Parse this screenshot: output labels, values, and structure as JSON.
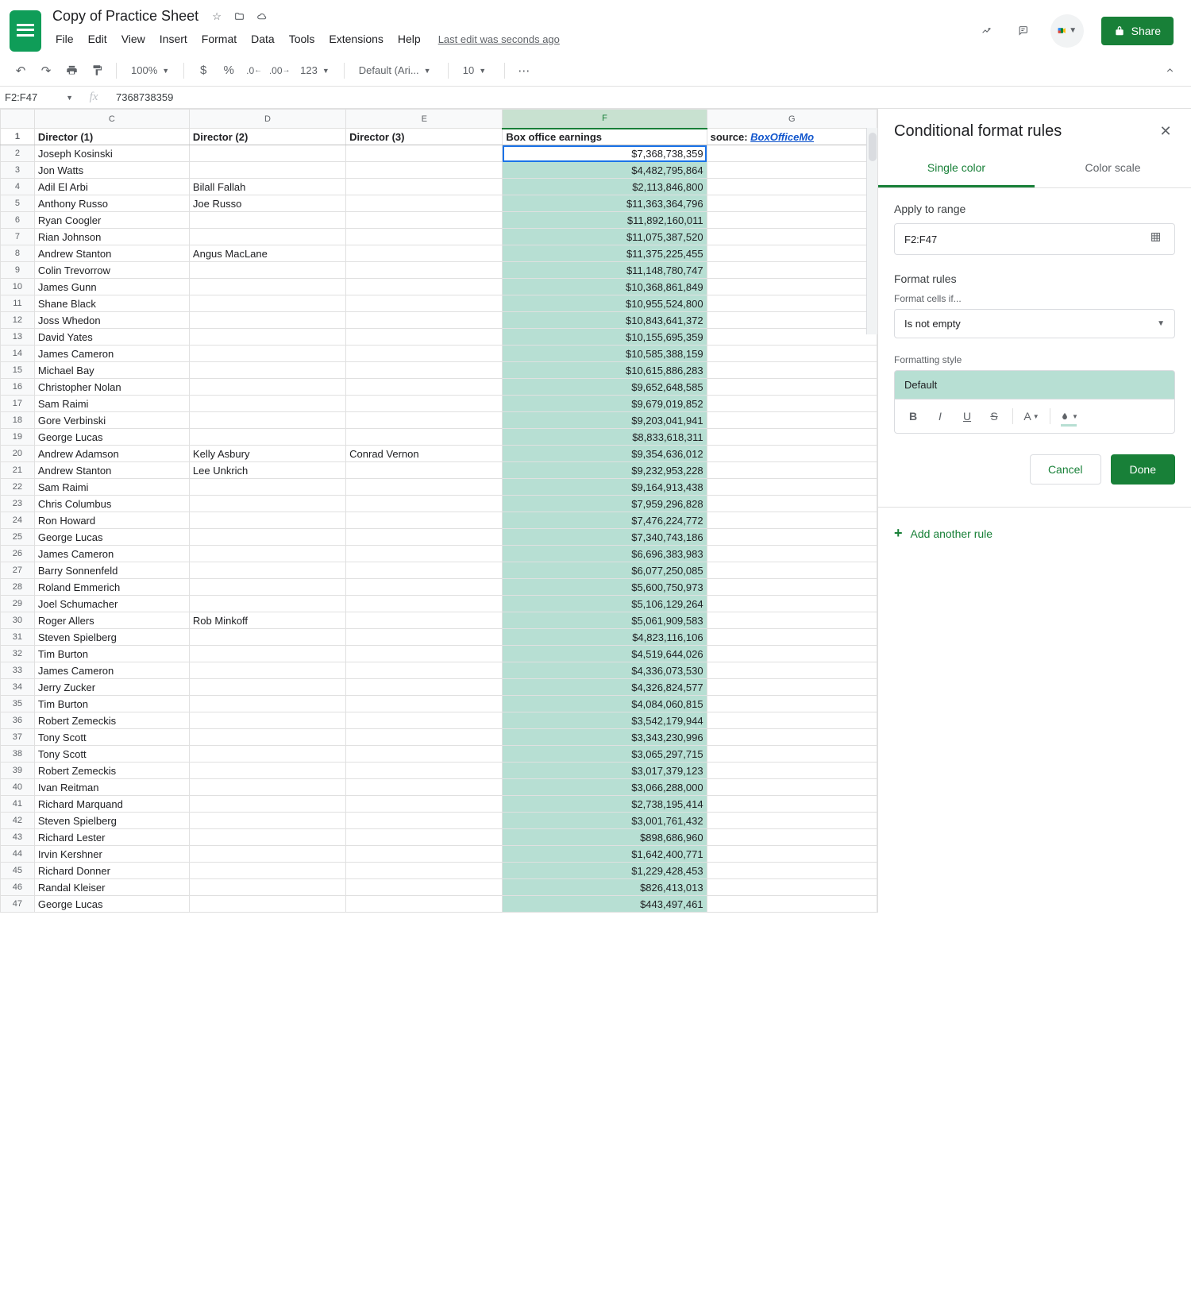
{
  "doc": {
    "title": "Copy of Practice Sheet",
    "last_edit": "Last edit was seconds ago",
    "share_label": "Share"
  },
  "menus": [
    "File",
    "Edit",
    "View",
    "Insert",
    "Format",
    "Data",
    "Tools",
    "Extensions",
    "Help"
  ],
  "toolbar": {
    "zoom": "100%",
    "font": "Default (Ari...",
    "font_size": "10",
    "fmt_auto": "123"
  },
  "name_box": "F2:F47",
  "formula_bar": "7368738359",
  "columns": [
    "C",
    "D",
    "E",
    "F",
    "G"
  ],
  "headers": {
    "c": "Director (1)",
    "d": "Director (2)",
    "e": "Director (3)",
    "f": "Box office earnings",
    "g_prefix": "source: ",
    "g_link": "BoxOfficeMo"
  },
  "rows": [
    {
      "n": 2,
      "c": "Joseph Kosinski",
      "d": "",
      "e": "",
      "f": "$7,368,738,359",
      "sel": true
    },
    {
      "n": 3,
      "c": "Jon Watts",
      "d": "",
      "e": "",
      "f": "$4,482,795,864"
    },
    {
      "n": 4,
      "c": "Adil El Arbi",
      "d": "Bilall Fallah",
      "e": "",
      "f": "$2,113,846,800"
    },
    {
      "n": 5,
      "c": "Anthony Russo",
      "d": "Joe Russo",
      "e": "",
      "f": "$11,363,364,796"
    },
    {
      "n": 6,
      "c": "Ryan Coogler",
      "d": "",
      "e": "",
      "f": "$11,892,160,011"
    },
    {
      "n": 7,
      "c": "Rian Johnson",
      "d": "",
      "e": "",
      "f": "$11,075,387,520"
    },
    {
      "n": 8,
      "c": "Andrew Stanton",
      "d": "Angus MacLane",
      "e": "",
      "f": "$11,375,225,455"
    },
    {
      "n": 9,
      "c": "Colin Trevorrow",
      "d": "",
      "e": "",
      "f": "$11,148,780,747"
    },
    {
      "n": 10,
      "c": "James Gunn",
      "d": "",
      "e": "",
      "f": "$10,368,861,849"
    },
    {
      "n": 11,
      "c": "Shane Black",
      "d": "",
      "e": "",
      "f": "$10,955,524,800"
    },
    {
      "n": 12,
      "c": "Joss Whedon",
      "d": "",
      "e": "",
      "f": "$10,843,641,372"
    },
    {
      "n": 13,
      "c": "David Yates",
      "d": "",
      "e": "",
      "f": "$10,155,695,359"
    },
    {
      "n": 14,
      "c": "James Cameron",
      "d": "",
      "e": "",
      "f": "$10,585,388,159"
    },
    {
      "n": 15,
      "c": "Michael Bay",
      "d": "",
      "e": "",
      "f": "$10,615,886,283"
    },
    {
      "n": 16,
      "c": "Christopher Nolan",
      "d": "",
      "e": "",
      "f": "$9,652,648,585"
    },
    {
      "n": 17,
      "c": "Sam Raimi",
      "d": "",
      "e": "",
      "f": "$9,679,019,852"
    },
    {
      "n": 18,
      "c": "Gore Verbinski",
      "d": "",
      "e": "",
      "f": "$9,203,041,941"
    },
    {
      "n": 19,
      "c": "George Lucas",
      "d": "",
      "e": "",
      "f": "$8,833,618,311"
    },
    {
      "n": 20,
      "c": "Andrew Adamson",
      "d": "Kelly Asbury",
      "e": "Conrad Vernon",
      "f": "$9,354,636,012"
    },
    {
      "n": 21,
      "c": "Andrew Stanton",
      "d": "Lee Unkrich",
      "e": "",
      "f": "$9,232,953,228"
    },
    {
      "n": 22,
      "c": "Sam Raimi",
      "d": "",
      "e": "",
      "f": "$9,164,913,438"
    },
    {
      "n": 23,
      "c": "Chris Columbus",
      "d": "",
      "e": "",
      "f": "$7,959,296,828"
    },
    {
      "n": 24,
      "c": "Ron Howard",
      "d": "",
      "e": "",
      "f": "$7,476,224,772"
    },
    {
      "n": 25,
      "c": "George Lucas",
      "d": "",
      "e": "",
      "f": "$7,340,743,186"
    },
    {
      "n": 26,
      "c": "James Cameron",
      "d": "",
      "e": "",
      "f": "$6,696,383,983"
    },
    {
      "n": 27,
      "c": "Barry Sonnenfeld",
      "d": "",
      "e": "",
      "f": "$6,077,250,085"
    },
    {
      "n": 28,
      "c": "Roland Emmerich",
      "d": "",
      "e": "",
      "f": "$5,600,750,973"
    },
    {
      "n": 29,
      "c": "Joel Schumacher",
      "d": "",
      "e": "",
      "f": "$5,106,129,264"
    },
    {
      "n": 30,
      "c": "Roger Allers",
      "d": "Rob Minkoff",
      "e": "",
      "f": "$5,061,909,583"
    },
    {
      "n": 31,
      "c": "Steven Spielberg",
      "d": "",
      "e": "",
      "f": "$4,823,116,106"
    },
    {
      "n": 32,
      "c": "Tim Burton",
      "d": "",
      "e": "",
      "f": "$4,519,644,026"
    },
    {
      "n": 33,
      "c": "James Cameron",
      "d": "",
      "e": "",
      "f": "$4,336,073,530"
    },
    {
      "n": 34,
      "c": "Jerry Zucker",
      "d": "",
      "e": "",
      "f": "$4,326,824,577"
    },
    {
      "n": 35,
      "c": "Tim Burton",
      "d": "",
      "e": "",
      "f": "$4,084,060,815"
    },
    {
      "n": 36,
      "c": "Robert Zemeckis",
      "d": "",
      "e": "",
      "f": "$3,542,179,944"
    },
    {
      "n": 37,
      "c": "Tony Scott",
      "d": "",
      "e": "",
      "f": "$3,343,230,996"
    },
    {
      "n": 38,
      "c": "Tony Scott",
      "d": "",
      "e": "",
      "f": "$3,065,297,715"
    },
    {
      "n": 39,
      "c": "Robert Zemeckis",
      "d": "",
      "e": "",
      "f": "$3,017,379,123"
    },
    {
      "n": 40,
      "c": "Ivan Reitman",
      "d": "",
      "e": "",
      "f": "$3,066,288,000"
    },
    {
      "n": 41,
      "c": "Richard Marquand",
      "d": "",
      "e": "",
      "f": "$2,738,195,414"
    },
    {
      "n": 42,
      "c": "Steven Spielberg",
      "d": "",
      "e": "",
      "f": "$3,001,761,432"
    },
    {
      "n": 43,
      "c": "Richard Lester",
      "d": "",
      "e": "",
      "f": "$898,686,960"
    },
    {
      "n": 44,
      "c": "Irvin Kershner",
      "d": "",
      "e": "",
      "f": "$1,642,400,771"
    },
    {
      "n": 45,
      "c": "Richard Donner",
      "d": "",
      "e": "",
      "f": "$1,229,428,453"
    },
    {
      "n": 46,
      "c": "Randal Kleiser",
      "d": "",
      "e": "",
      "f": "$826,413,013"
    },
    {
      "n": 47,
      "c": "George Lucas",
      "d": "",
      "e": "",
      "f": "$443,497,461"
    }
  ],
  "sidebar": {
    "title": "Conditional format rules",
    "tab_single": "Single color",
    "tab_scale": "Color scale",
    "apply_label": "Apply to range",
    "range_value": "F2:F47",
    "rules_title": "Format rules",
    "format_if_label": "Format cells if...",
    "condition": "Is not empty",
    "style_label": "Formatting style",
    "style_preview": "Default",
    "cancel": "Cancel",
    "done": "Done",
    "add_rule": "Add another rule"
  }
}
